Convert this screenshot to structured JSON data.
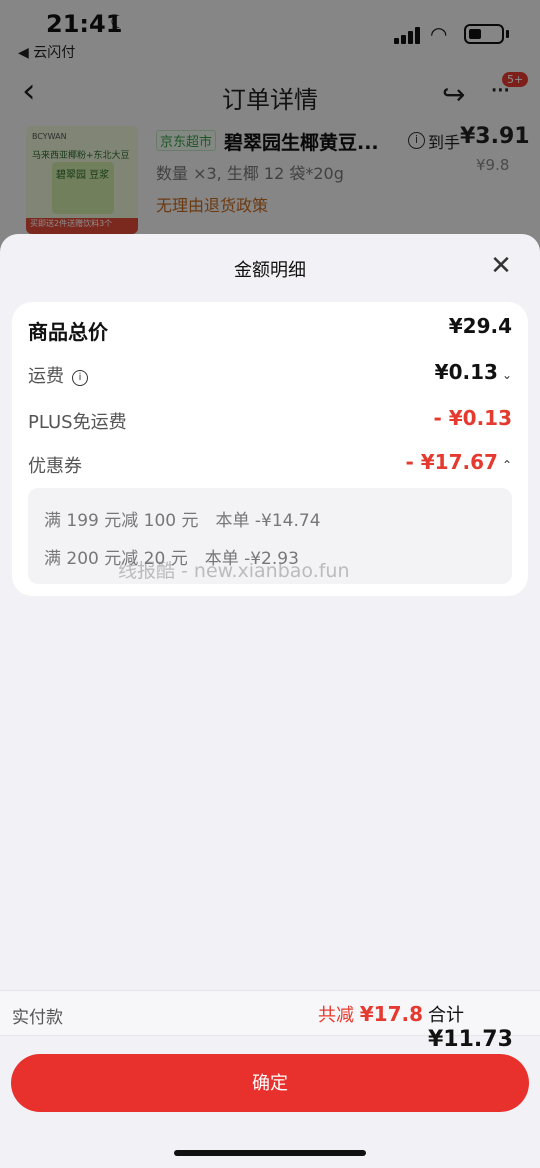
{
  "status_bar": {
    "time": "21:41",
    "back_app": "◀ 云闪付"
  },
  "nav": {
    "title": "订单详情",
    "badge": "5+"
  },
  "product": {
    "store_tag": "京东超市",
    "name": "碧翠园生椰黄豆...",
    "arrive_label": "到手",
    "arrive_price": "¥3.91",
    "original_price": "¥9.8",
    "quantity": "数量 ×3, 生椰 12 袋*20g",
    "policy": "无理由退货政策",
    "image_text_brand": "BCYWAN",
    "image_text_line": "马来西亚椰粉+东北大豆",
    "image_text_pack": "碧翠园 豆浆",
    "image_text_bottom": "买即送2件送赠饮料3个"
  },
  "sheet": {
    "title": "金额明细",
    "rows": {
      "total": {
        "label": "商品总价",
        "value": "¥29.4"
      },
      "shipping": {
        "label": "运费",
        "value": "¥0.13"
      },
      "plus": {
        "label": "PLUS免运费",
        "value": "- ¥0.13"
      },
      "coupon": {
        "label": "优惠券",
        "value": "- ¥17.67"
      }
    },
    "coupons": [
      "满 199 元减 100 元　本单 -¥14.74",
      "满 200 元减 20 元　本单 -¥2.93"
    ],
    "watermark": "线报酷 - new.xianbao.fun"
  },
  "bottom": {
    "pay_label": "实付款",
    "discount_prefix": "共减",
    "discount_value": "¥17.8",
    "sum_prefix": "合计",
    "sum_value": "¥11.73",
    "confirm_label": "确定"
  },
  "colors": {
    "accent": "#e8302c",
    "discount_red": "#e53a2f"
  }
}
